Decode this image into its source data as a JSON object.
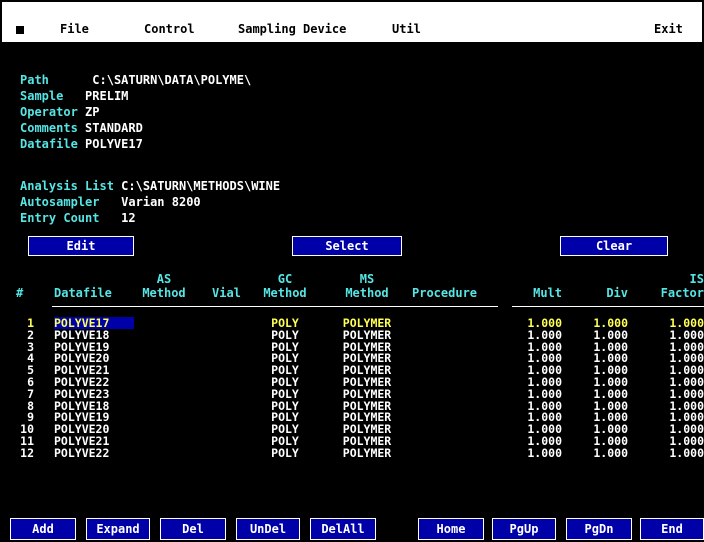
{
  "menu": {
    "file": "File",
    "control": "Control",
    "sampling_device": "Sampling Device",
    "util": "Util",
    "exit": "Exit"
  },
  "info": {
    "path_label": "Path",
    "path_value": "C:\\SATURN\\DATA\\POLYME\\",
    "sample_label": "Sample",
    "sample_value": "PRELIM",
    "operator_label": "Operator",
    "operator_value": "ZP",
    "comments_label": "Comments",
    "comments_value": "STANDARD",
    "datafile_label": "Datafile",
    "datafile_value": "POLYVE17",
    "analysis_label": "Analysis List",
    "analysis_value": "C:\\SATURN\\METHODS\\WINE",
    "autosampler_label": "Autosampler",
    "autosampler_value": "Varian 8200",
    "entry_label": "Entry Count",
    "entry_value": "12"
  },
  "buttons": {
    "edit": "Edit",
    "select": "Select",
    "clear": "Clear"
  },
  "table": {
    "headers": {
      "num": "#",
      "datafile": "Datafile",
      "as1": "AS",
      "as2": "Method",
      "vial": "Vial",
      "gc1": "GC",
      "gc2": "Method",
      "ms1": "MS",
      "ms2": "Method",
      "procedure": "Procedure",
      "mult": "Mult",
      "div": "Div",
      "is1": "IS",
      "is2": "Factor"
    },
    "rows": [
      {
        "num": "1",
        "datafile": "POLYVE17",
        "gc": "POLY",
        "ms": "POLYMER",
        "mult": "1.000",
        "div": "1.000",
        "is": "1.000"
      },
      {
        "num": "2",
        "datafile": "POLYVE18",
        "gc": "POLY",
        "ms": "POLYMER",
        "mult": "1.000",
        "div": "1.000",
        "is": "1.000"
      },
      {
        "num": "3",
        "datafile": "POLYVE19",
        "gc": "POLY",
        "ms": "POLYMER",
        "mult": "1.000",
        "div": "1.000",
        "is": "1.000"
      },
      {
        "num": "4",
        "datafile": "POLYVE20",
        "gc": "POLY",
        "ms": "POLYMER",
        "mult": "1.000",
        "div": "1.000",
        "is": "1.000"
      },
      {
        "num": "5",
        "datafile": "POLYVE21",
        "gc": "POLY",
        "ms": "POLYMER",
        "mult": "1.000",
        "div": "1.000",
        "is": "1.000"
      },
      {
        "num": "6",
        "datafile": "POLYVE22",
        "gc": "POLY",
        "ms": "POLYMER",
        "mult": "1.000",
        "div": "1.000",
        "is": "1.000"
      },
      {
        "num": "7",
        "datafile": "POLYVE23",
        "gc": "POLY",
        "ms": "POLYMER",
        "mult": "1.000",
        "div": "1.000",
        "is": "1.000"
      },
      {
        "num": "8",
        "datafile": "POLYVE18",
        "gc": "POLY",
        "ms": "POLYMER",
        "mult": "1.000",
        "div": "1.000",
        "is": "1.000"
      },
      {
        "num": "9",
        "datafile": "POLYVE19",
        "gc": "POLY",
        "ms": "POLYMER",
        "mult": "1.000",
        "div": "1.000",
        "is": "1.000"
      },
      {
        "num": "10",
        "datafile": "POLYVE20",
        "gc": "POLY",
        "ms": "POLYMER",
        "mult": "1.000",
        "div": "1.000",
        "is": "1.000"
      },
      {
        "num": "11",
        "datafile": "POLYVE21",
        "gc": "POLY",
        "ms": "POLYMER",
        "mult": "1.000",
        "div": "1.000",
        "is": "1.000"
      },
      {
        "num": "12",
        "datafile": "POLYVE22",
        "gc": "POLY",
        "ms": "POLYMER",
        "mult": "1.000",
        "div": "1.000",
        "is": "1.000"
      }
    ]
  },
  "bottom_buttons": {
    "add": "Add",
    "expand": "Expand",
    "del": "Del",
    "undel": "UnDel",
    "delall": "DelAll",
    "home": "Home",
    "pgup": "PgUp",
    "pgdn": "PgDn",
    "end": "End"
  },
  "colors": {
    "label": "#56e5e5",
    "highlight": "#ffff55",
    "button_bg": "#0000a8"
  }
}
